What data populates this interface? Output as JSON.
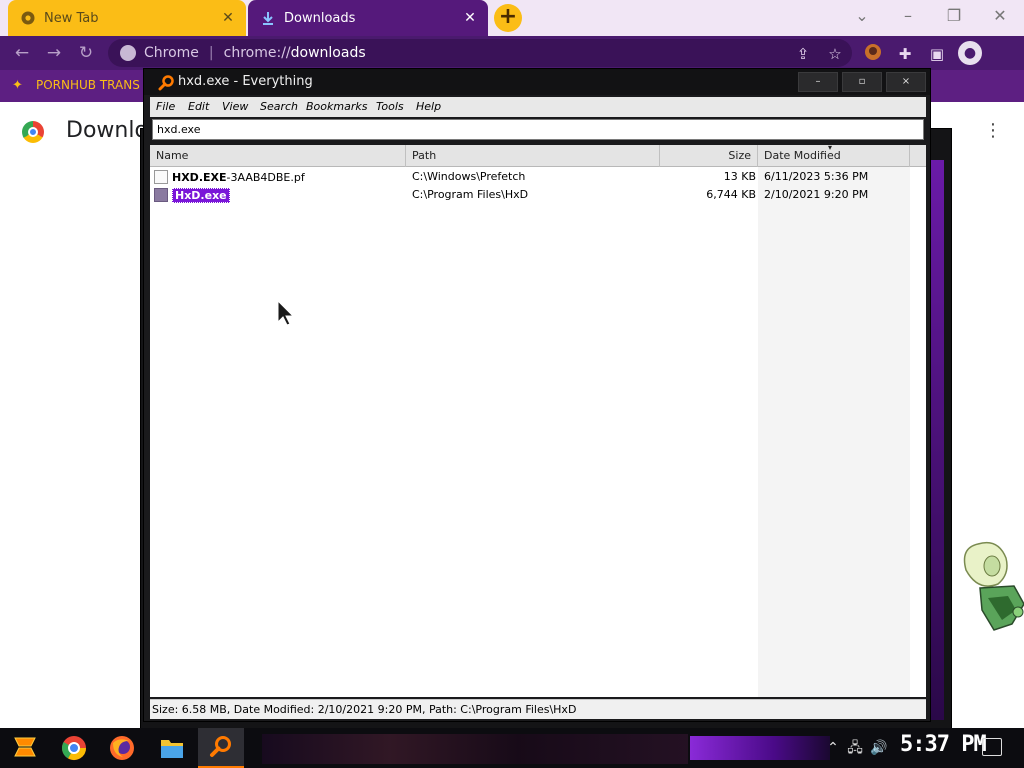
{
  "browser": {
    "tabs": [
      {
        "title": "New Tab",
        "icon": "chrome-icon"
      },
      {
        "title": "Downloads",
        "icon": "download-icon"
      }
    ],
    "omnibox": {
      "site_label": "Chrome",
      "url_prefix": "chrome://",
      "url_path": "downloads"
    },
    "bookmark": {
      "label": "PORNHUB TRANS"
    },
    "page_title": "Downlo"
  },
  "everything": {
    "title": "hxd.exe - Everything",
    "menu": [
      "File",
      "Edit",
      "View",
      "Search",
      "Bookmarks",
      "Tools",
      "Help"
    ],
    "search_value": "hxd.exe",
    "columns": [
      "Name",
      "Path",
      "Size",
      "Date Modified"
    ],
    "rows": [
      {
        "name_bold": "HXD.EXE",
        "name_rest": "-3AAB4DBE.pf",
        "path": "C:\\Windows\\Prefetch",
        "size": "13 KB",
        "date": "6/11/2023 5:36 PM"
      },
      {
        "name_bold": "HxD.exe",
        "name_rest": "",
        "path": "C:\\Program Files\\HxD",
        "size": "6,744 KB",
        "date": "2/10/2021 9:20 PM"
      }
    ],
    "status": "Size: 6.58 MB, Date Modified: 2/10/2021 9:20 PM, Path: C:\\Program Files\\HxD",
    "window_buttons": {
      "minimize": "–",
      "maximize": "▫",
      "close": "×"
    }
  },
  "taskbar": {
    "clock": "5:37 PM"
  },
  "colors": {
    "chrome_tab_active": "#55197b",
    "chrome_tab_inactive": "#fbbd16",
    "chrome_toolbar": "#4a1a6e",
    "selection": "#7a16d8",
    "everything_accent": "#ff7a00"
  }
}
